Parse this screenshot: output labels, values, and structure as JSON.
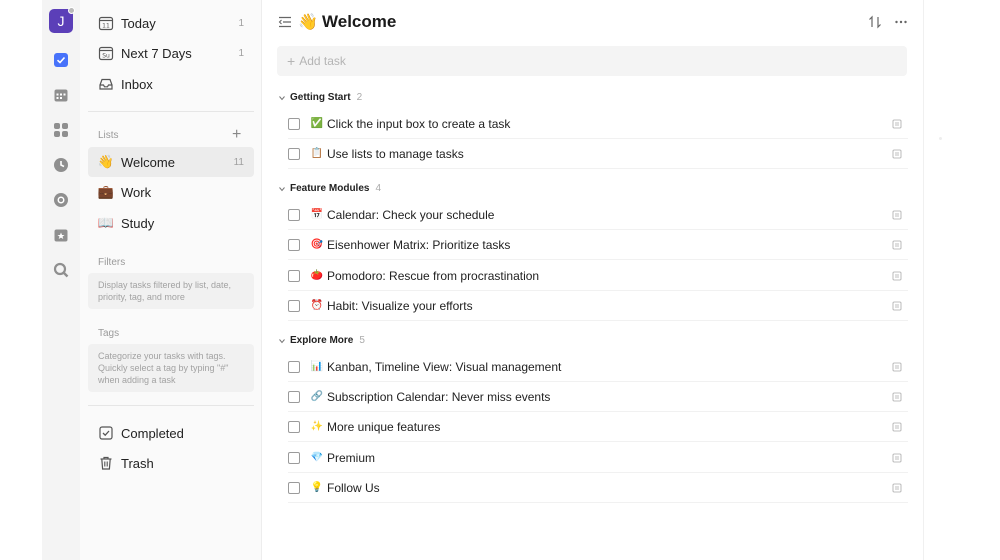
{
  "rail": {
    "avatar_letter": "J",
    "icons": [
      "task-icon",
      "calendar-icon",
      "matrix-icon",
      "pomodoro-icon",
      "habit-icon",
      "countdown-icon",
      "search-icon"
    ]
  },
  "sidebar": {
    "smart_lists": [
      {
        "label": "Today",
        "count": "1",
        "icon": "calendar-day-icon"
      },
      {
        "label": "Next 7 Days",
        "count": "1",
        "icon": "calendar-week-icon"
      },
      {
        "label": "Inbox",
        "count": "",
        "icon": "inbox-icon"
      }
    ],
    "lists_title": "Lists",
    "lists": [
      {
        "label": "Welcome",
        "count": "11",
        "emoji": "👋"
      },
      {
        "label": "Work",
        "count": "",
        "emoji": "💼"
      },
      {
        "label": "Study",
        "count": "",
        "emoji": "📖"
      }
    ],
    "filters_title": "Filters",
    "filters_hint": "Display tasks filtered by list, date, priority, tag, and more",
    "tags_title": "Tags",
    "tags_hint": "Categorize your tasks with tags. Quickly select a tag by typing \"#\" when adding a task",
    "completed_label": "Completed",
    "trash_label": "Trash"
  },
  "main": {
    "title_emoji": "👋",
    "title": "Welcome",
    "add_task_placeholder": "Add task",
    "groups": [
      {
        "name": "Getting Start",
        "count": "2",
        "tasks": [
          {
            "emoji": "✅",
            "title": "Click the input box to create a task"
          },
          {
            "emoji": "📋",
            "title": "Use lists to manage tasks"
          }
        ]
      },
      {
        "name": "Feature Modules",
        "count": "4",
        "tasks": [
          {
            "emoji": "📅",
            "title": "Calendar: Check your schedule"
          },
          {
            "emoji": "🎯",
            "title": "Eisenhower Matrix: Prioritize tasks"
          },
          {
            "emoji": "🍅",
            "title": "Pomodoro: Rescue from procrastination"
          },
          {
            "emoji": "⏰",
            "title": "Habit: Visualize your efforts"
          }
        ]
      },
      {
        "name": "Explore More",
        "count": "5",
        "tasks": [
          {
            "emoji": "📊",
            "title": "Kanban, Timeline View: Visual management"
          },
          {
            "emoji": "🔗",
            "title": "Subscription Calendar: Never miss events"
          },
          {
            "emoji": "✨",
            "title": "More unique features"
          },
          {
            "emoji": "💎",
            "title": "Premium"
          },
          {
            "emoji": "💡",
            "title": "Follow Us"
          }
        ]
      }
    ]
  },
  "colors": {
    "accent": "#4772fa",
    "avatar": "#5b3fb8"
  }
}
